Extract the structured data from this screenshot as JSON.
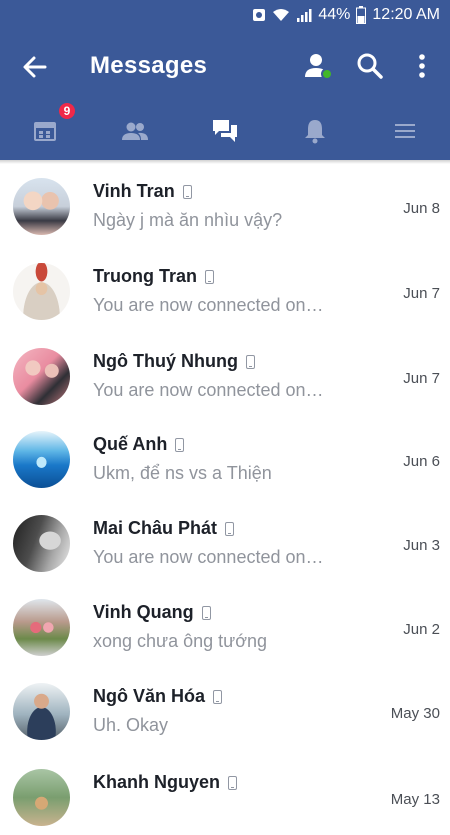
{
  "status_bar": {
    "battery": "44%",
    "time": "12:20 AM"
  },
  "app_bar": {
    "title": "Messages"
  },
  "tabs": {
    "notifications_badge": "9"
  },
  "colors": {
    "brand": "#3b5998",
    "badge": "#f02849",
    "online": "#42b72a"
  },
  "conversations": [
    {
      "name": "Vinh Tran",
      "preview": "Ngày j mà ăn nhìu vậy?",
      "date": "Jun 8"
    },
    {
      "name": "Truong Tran",
      "preview": "You are now connected on…",
      "date": "Jun 7"
    },
    {
      "name": "Ngô Thuý Nhung",
      "preview": "You are now connected on…",
      "date": "Jun 7"
    },
    {
      "name": "Quế Anh",
      "preview": "Ukm, để ns vs a Thiện",
      "date": "Jun 6"
    },
    {
      "name": "Mai Châu Phát",
      "preview": "You are now connected on…",
      "date": "Jun 3"
    },
    {
      "name": "Vinh Quang",
      "preview": "xong chưa ông tướng",
      "date": "Jun 2"
    },
    {
      "name": "Ngô Văn Hóa",
      "preview": "Uh. Okay",
      "date": "May 30"
    },
    {
      "name": "Khanh Nguyen",
      "preview": "",
      "date": "May 13"
    }
  ]
}
